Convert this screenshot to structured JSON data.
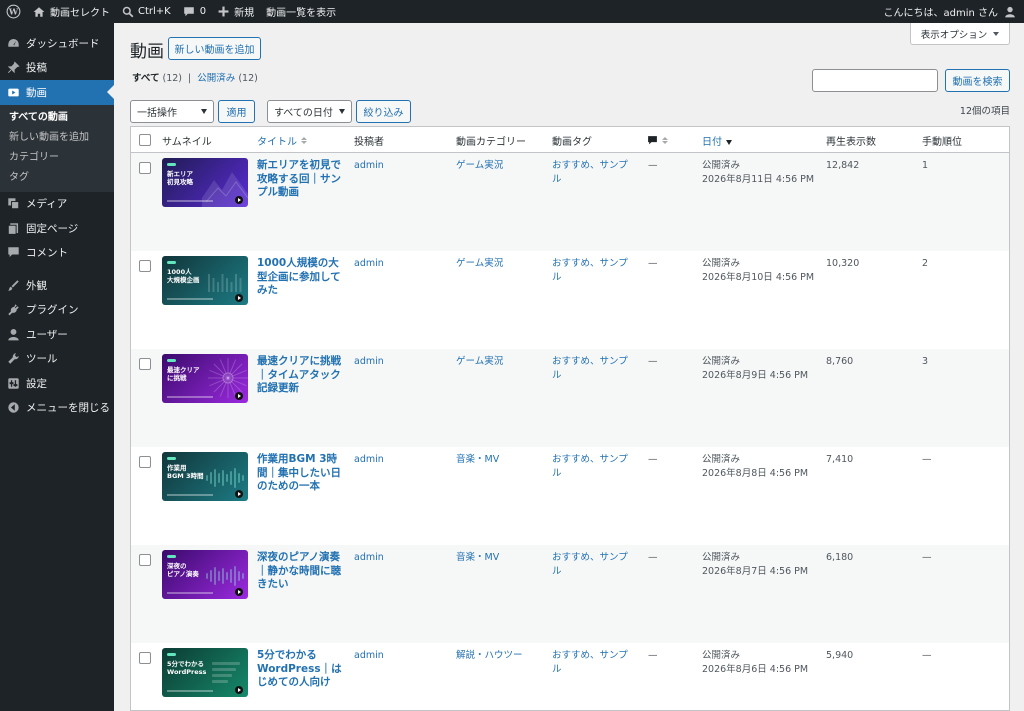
{
  "adminbar": {
    "site_name": "動画セレクト",
    "shortcut": "Ctrl+K",
    "comments_count": "0",
    "new_label": "新規",
    "view_list": "動画一覧を表示",
    "greeting": "こんにちは、admin さん"
  },
  "sidebar": {
    "items_top": [
      {
        "label": "ダッシュボード",
        "icon": "dashboard-icon"
      },
      {
        "label": "投稿",
        "icon": "pushpin-icon"
      }
    ],
    "current": {
      "label": "動画",
      "icon": "video-icon"
    },
    "submenu": [
      "すべての動画",
      "新しい動画を追加",
      "カテゴリー",
      "タグ"
    ],
    "items_bottom": [
      {
        "label": "メディア",
        "icon": "media-icon"
      },
      {
        "label": "固定ページ",
        "icon": "page-icon"
      },
      {
        "label": "コメント",
        "icon": "comment-icon"
      },
      {
        "label": "外観",
        "icon": "brush-icon"
      },
      {
        "label": "プラグイン",
        "icon": "plugin-icon"
      },
      {
        "label": "ユーザー",
        "icon": "user-icon"
      },
      {
        "label": "ツール",
        "icon": "wrench-icon"
      },
      {
        "label": "設定",
        "icon": "settings-icon"
      },
      {
        "label": "メニューを閉じる",
        "icon": "collapse-icon"
      }
    ]
  },
  "main": {
    "title": "動画",
    "add_new": "新しい動画を追加",
    "screen_options": "表示オプション",
    "filters": {
      "all_label": "すべて",
      "all_count": "(12)",
      "separator": "|",
      "published_label": "公開済み",
      "published_count": "(12)"
    },
    "search_value": "",
    "search_button": "動画を検索",
    "bulk_action": "一括操作",
    "apply": "適用",
    "date_filter": "すべての日付",
    "filter_button": "絞り込み",
    "items_count": "12個の項目"
  },
  "table": {
    "columns": {
      "thumbnail": "サムネイル",
      "title": "タイトル",
      "author": "投稿者",
      "category": "動画カテゴリー",
      "tags": "動画タグ",
      "date": "日付",
      "views": "再生表示数",
      "order": "手動順位"
    },
    "rows": [
      {
        "thumb_text": "新エリア\n初見攻略",
        "title": "新エリアを初見で攻略する回｜サンプル動画",
        "author": "admin",
        "category": "ゲーム実況",
        "tags": "おすすめ、サンプル",
        "comments": "—",
        "status": "公開済み",
        "date": "2026年8月11日 4:56 PM",
        "views": "12,842",
        "order": "1"
      },
      {
        "thumb_text": "1000人\n大規模企画",
        "title": "1000人規模の大型企画に参加してみた",
        "author": "admin",
        "category": "ゲーム実況",
        "tags": "おすすめ、サンプル",
        "comments": "—",
        "status": "公開済み",
        "date": "2026年8月10日 4:56 PM",
        "views": "10,320",
        "order": "2"
      },
      {
        "thumb_text": "最速クリア\nに挑戦",
        "title": "最速クリアに挑戦｜タイムアタック記録更新",
        "author": "admin",
        "category": "ゲーム実況",
        "tags": "おすすめ、サンプル",
        "comments": "—",
        "status": "公開済み",
        "date": "2026年8月9日 4:56 PM",
        "views": "8,760",
        "order": "3"
      },
      {
        "thumb_text": "作業用\nBGM 3時間",
        "title": "作業用BGM 3時間｜集中したい日のための一本",
        "author": "admin",
        "category": "音楽・MV",
        "tags": "おすすめ、サンプル",
        "comments": "—",
        "status": "公開済み",
        "date": "2026年8月8日 4:56 PM",
        "views": "7,410",
        "order": "—"
      },
      {
        "thumb_text": "深夜の\nピアノ演奏",
        "title": "深夜のピアノ演奏｜静かな時間に聴きたい",
        "author": "admin",
        "category": "音楽・MV",
        "tags": "おすすめ、サンプル",
        "comments": "—",
        "status": "公開済み",
        "date": "2026年8月7日 4:56 PM",
        "views": "6,180",
        "order": "—"
      },
      {
        "thumb_text": "5分でわかる\nWordPress",
        "title": "5分でわかるWordPress｜はじめての人向け",
        "author": "admin",
        "category": "解説・ハウツー",
        "tags": "おすすめ、サンプル",
        "comments": "—",
        "status": "公開済み",
        "date": "2026年8月6日 4:56 PM",
        "views": "5,940",
        "order": "—"
      }
    ]
  },
  "colors": {
    "accent": "#2271b1",
    "adminbar_bg": "#1d2327",
    "thumb_game": [
      "#1f1c52",
      "#5b2bd6"
    ],
    "thumb_teal": [
      "#11363a",
      "#1d7b84"
    ],
    "thumb_purple": [
      "#3a0a6b",
      "#9b2ae0"
    ],
    "thumb_green": [
      "#0c3b34",
      "#168a6a"
    ]
  }
}
